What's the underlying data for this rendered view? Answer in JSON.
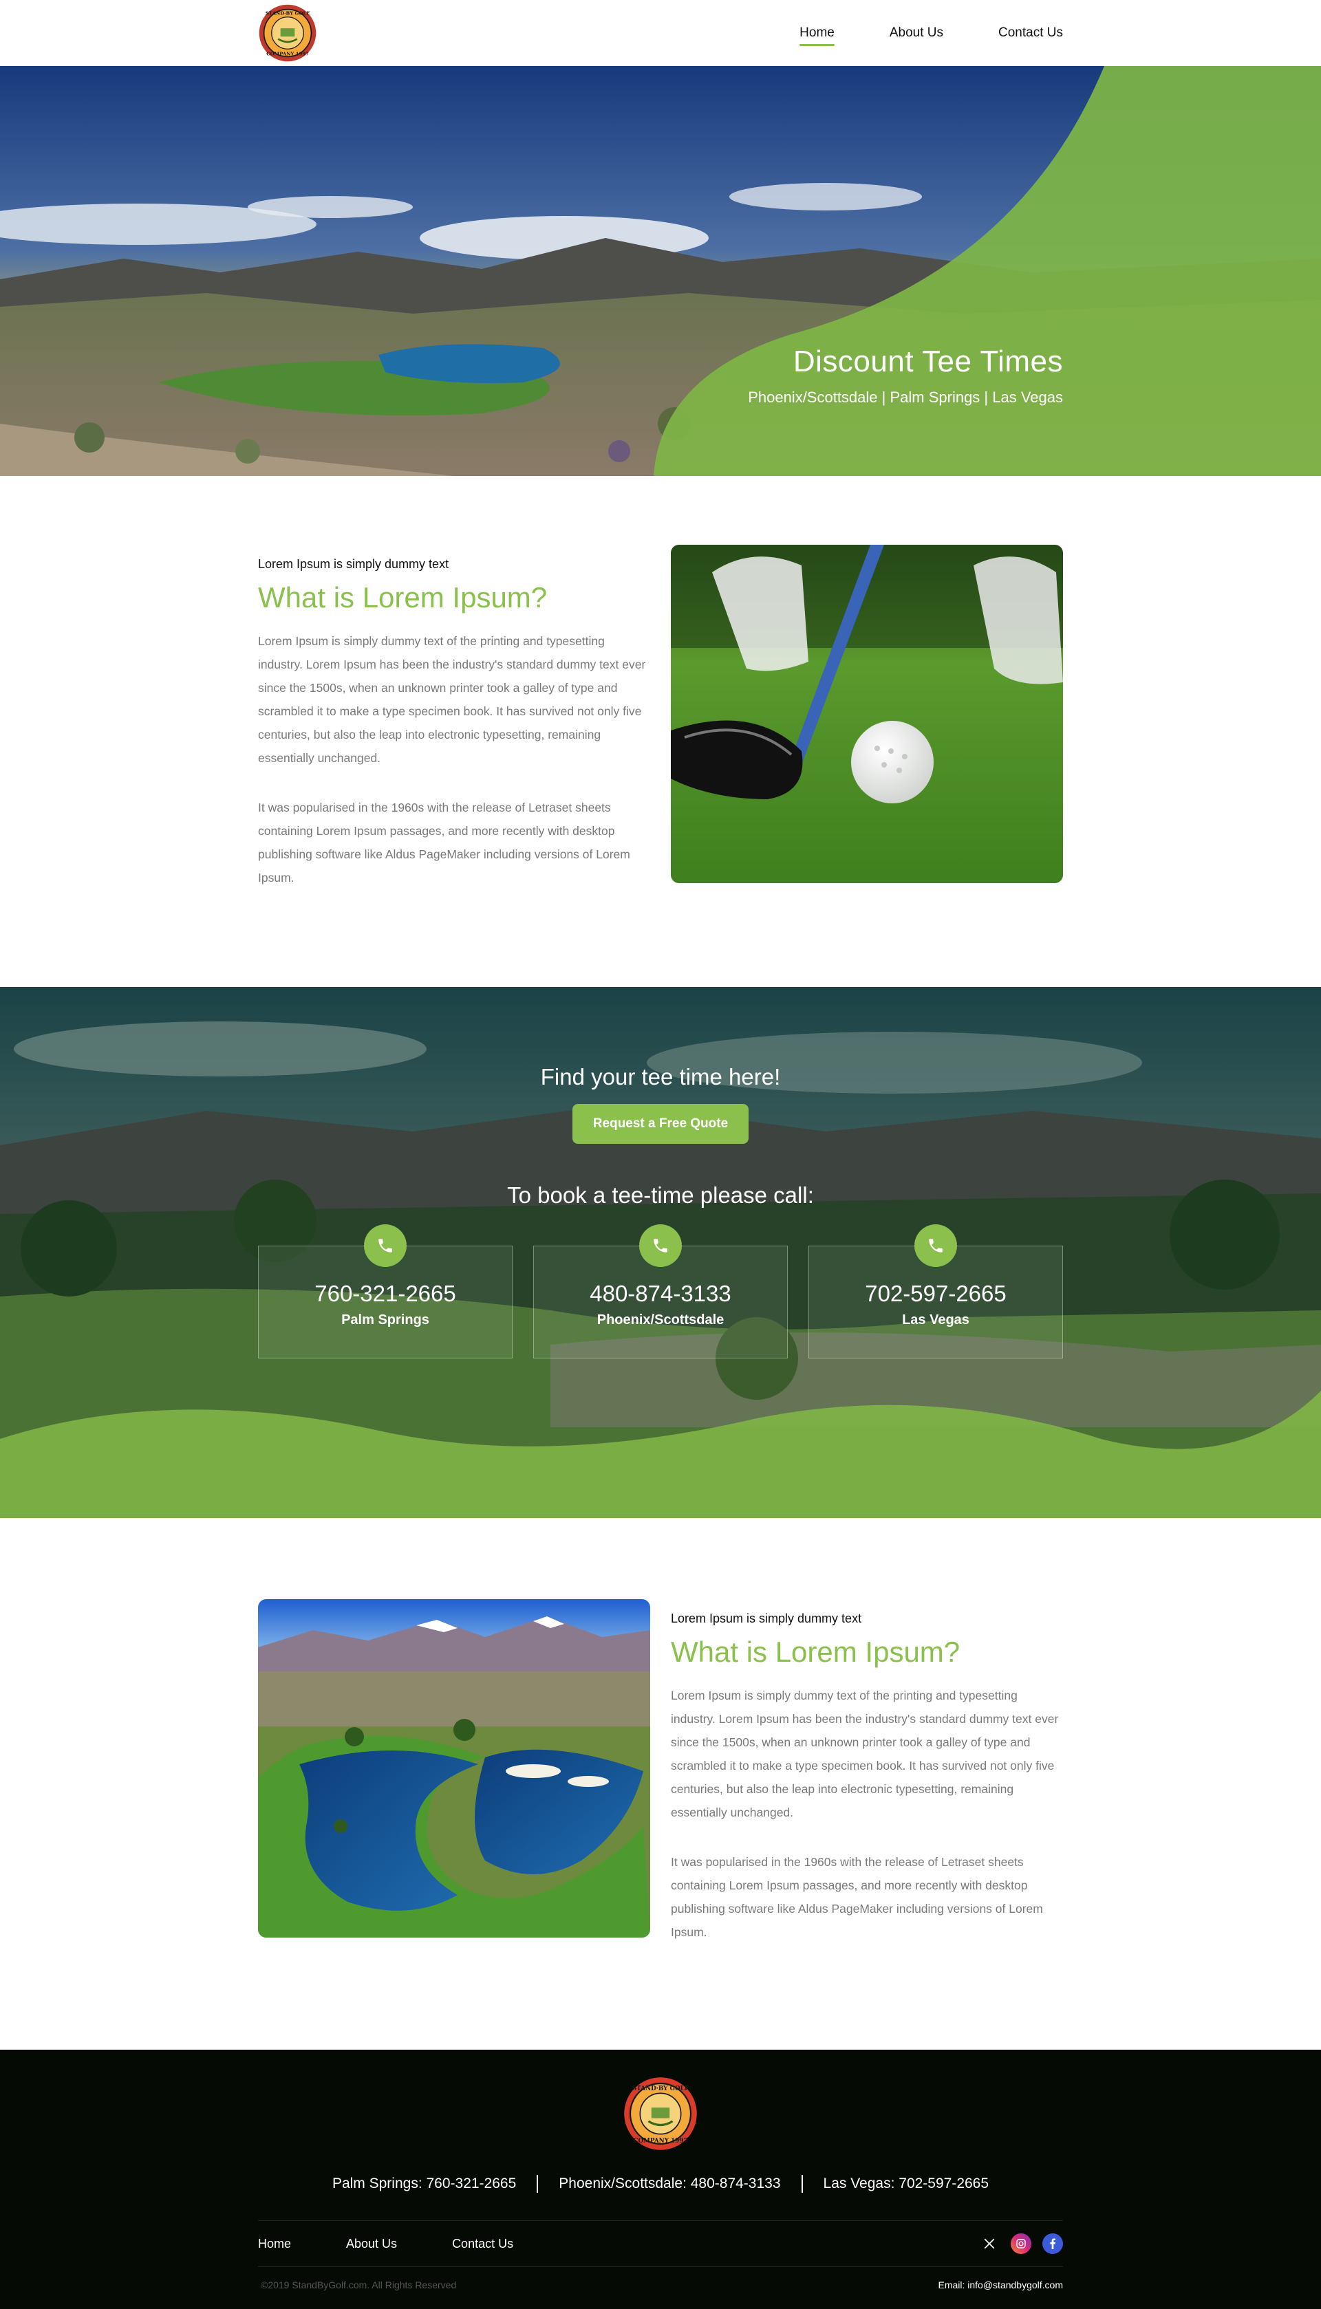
{
  "brand": {
    "logo_alt": "Stand-By Golf Company",
    "logo_text_top": "STAND-BY GOLF",
    "logo_text_bottom": "COMPANY 1997",
    "colors": {
      "green": "#8cc04d",
      "dark": "#050a05"
    }
  },
  "nav": {
    "items": [
      {
        "label": "Home",
        "active": true
      },
      {
        "label": "About Us",
        "active": false
      },
      {
        "label": "Contact Us",
        "active": false
      }
    ]
  },
  "hero": {
    "title": "Discount Tee Times",
    "subtitle": "Phoenix/Scottsdale | Palm Springs | Las Vegas",
    "prev_icon": "arrow-left-icon",
    "next_icon": "arrow-right-icon"
  },
  "about1": {
    "eyebrow": "Lorem Ipsum is simply dummy text",
    "title": "What is Lorem Ipsum?",
    "para1": "Lorem Ipsum is simply dummy text of the printing and typesetting industry. Lorem Ipsum has been the industry's standard dummy text ever since the 1500s, when an unknown printer took a galley of type and scrambled it to make a type specimen book. It has survived not only five centuries, but also the leap into electronic typesetting, remaining essentially unchanged.",
    "para2": "It was popularised in the 1960s with the release of Letraset sheets containing Lorem Ipsum passages, and more recently with desktop publishing software like Aldus PageMaker including versions of Lorem Ipsum."
  },
  "tee": {
    "heading": "Find your tee time here!",
    "button": "Request a Free Quote",
    "call": "To book a tee-time please call:",
    "cards": [
      {
        "phone": "760-321-2665",
        "city": "Palm Springs"
      },
      {
        "phone": "480-874-3133",
        "city": "Phoenix/Scottsdale"
      },
      {
        "phone": "702-597-2665",
        "city": "Las Vegas"
      }
    ]
  },
  "about2": {
    "eyebrow": "Lorem Ipsum is simply dummy text",
    "title": "What is Lorem Ipsum?",
    "para1": "Lorem Ipsum is simply dummy text of the printing and typesetting industry. Lorem Ipsum has been the industry's standard dummy text ever since the 1500s, when an unknown printer took a galley of type and scrambled it to make a type specimen book. It has survived not only five centuries, but also the leap into electronic typesetting, remaining essentially unchanged.",
    "para2": "It was popularised in the 1960s with the release of Letraset sheets containing Lorem Ipsum passages, and more recently with desktop publishing software like Aldus PageMaker including versions of Lorem Ipsum."
  },
  "footer": {
    "phones": [
      "Palm Springs: 760-321-2665",
      "Phoenix/Scottsdale: 480-874-3133",
      "Las Vegas: 702-597-2665"
    ],
    "nav": [
      "Home",
      "About Us",
      "Contact Us"
    ],
    "socials": [
      {
        "icon": "x-twitter-icon",
        "glyph": "𝕏",
        "color": "#ffffff"
      },
      {
        "icon": "instagram-icon",
        "glyph": "◎",
        "color": "#e1306c"
      },
      {
        "icon": "facebook-icon",
        "glyph": "f",
        "color": "#3b5bdb"
      }
    ],
    "copyright": "©2019 StandByGolf.com. All Rights Reserved",
    "email": "Email: info@standbygolf.com"
  }
}
